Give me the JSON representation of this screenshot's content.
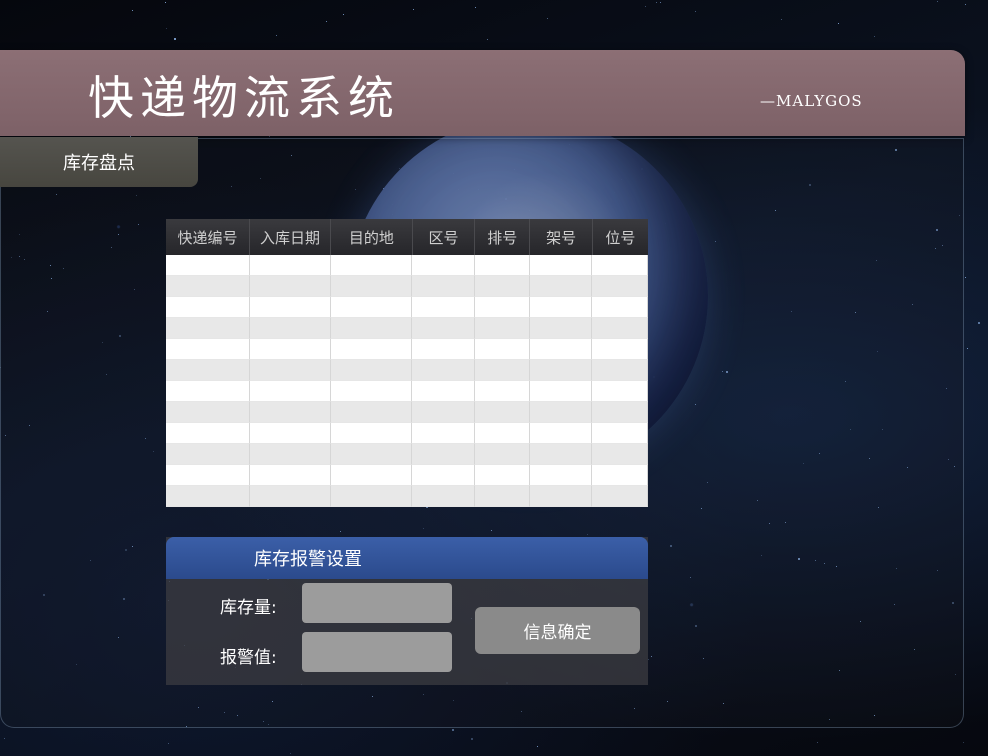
{
  "header": {
    "title": "快递物流系统",
    "subtitle": "—MALYGOS"
  },
  "nav": {
    "tab_label": "库存盘点"
  },
  "table": {
    "columns": [
      "快递编号",
      "入库日期",
      "目的地",
      "区号",
      "排号",
      "架号",
      "位号"
    ],
    "rows": [
      [
        "",
        "",
        "",
        "",
        "",
        "",
        ""
      ],
      [
        "",
        "",
        "",
        "",
        "",
        "",
        ""
      ],
      [
        "",
        "",
        "",
        "",
        "",
        "",
        ""
      ],
      [
        "",
        "",
        "",
        "",
        "",
        "",
        ""
      ],
      [
        "",
        "",
        "",
        "",
        "",
        "",
        ""
      ],
      [
        "",
        "",
        "",
        "",
        "",
        "",
        ""
      ],
      [
        "",
        "",
        "",
        "",
        "",
        "",
        ""
      ],
      [
        "",
        "",
        "",
        "",
        "",
        "",
        ""
      ],
      [
        "",
        "",
        "",
        "",
        "",
        "",
        ""
      ],
      [
        "",
        "",
        "",
        "",
        "",
        "",
        ""
      ],
      [
        "",
        "",
        "",
        "",
        "",
        "",
        ""
      ],
      [
        "",
        "",
        "",
        "",
        "",
        "",
        ""
      ]
    ]
  },
  "alarm": {
    "title": "库存报警设置",
    "stock_label": "库存量:",
    "stock_value": "",
    "alert_label": "报警值:",
    "alert_value": "",
    "confirm_label": "信息确定"
  }
}
